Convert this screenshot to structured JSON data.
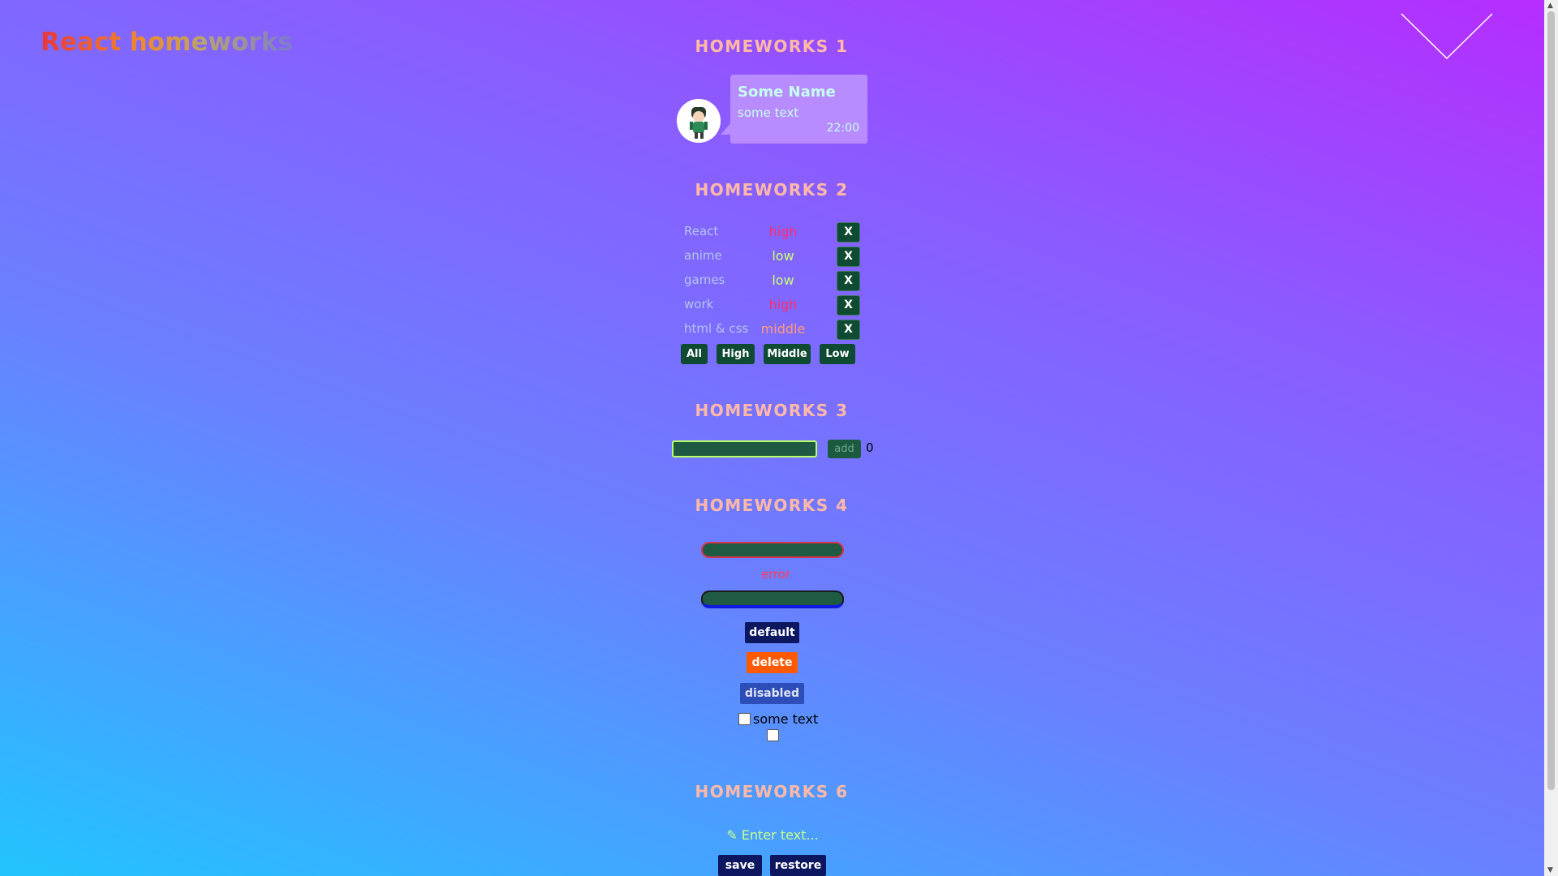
{
  "header": {
    "logo": "React homeworks"
  },
  "sections": {
    "hw1": {
      "title": "HOMEWORKS 1"
    },
    "hw2": {
      "title": "HOMEWORKS 2"
    },
    "hw3": {
      "title": "HOMEWORKS 3"
    },
    "hw4": {
      "title": "HOMEWORKS 4"
    },
    "hw6": {
      "title": "HOMEWORKS 6"
    }
  },
  "message": {
    "name": "Some Name",
    "text": "some text",
    "time": "22:00"
  },
  "affairs": [
    {
      "name": "React",
      "priority": "high",
      "color": "#ff2a6a"
    },
    {
      "name": "anime",
      "priority": "low",
      "color": "#c7ff6b"
    },
    {
      "name": "games",
      "priority": "low",
      "color": "#c7ff6b"
    },
    {
      "name": "work",
      "priority": "high",
      "color": "#ff2a6a"
    },
    {
      "name": "html & css",
      "priority": "middle",
      "color": "#ff9a7a"
    }
  ],
  "delete_label": "X",
  "filters": {
    "all": "All",
    "high": "High",
    "middle": "Middle",
    "low": "Low"
  },
  "hw3": {
    "add_label": "add",
    "count": "0"
  },
  "hw4": {
    "error": "error",
    "default_label": "default",
    "delete_label": "delete",
    "disabled_label": "disabled",
    "checkbox_label": "some text"
  },
  "hw6": {
    "placeholder": "✎ Enter text...",
    "save_label": "save",
    "restore_label": "restore"
  },
  "colors": {
    "heading": "#ffb9a6",
    "button": "#0f4a33",
    "accent_green": "#c7ff6b",
    "danger": "#ff2a6a"
  }
}
